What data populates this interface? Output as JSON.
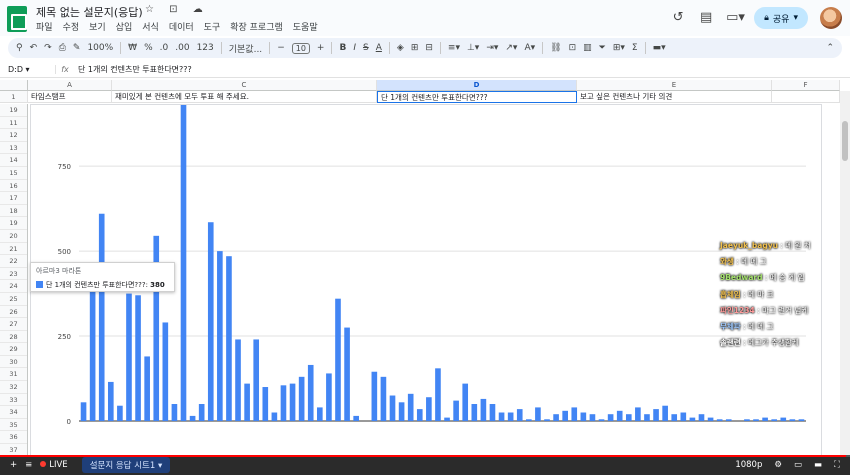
{
  "app": {
    "title": "제목 없는 설문지(응답)",
    "title_icons": "☆ ⊡ ☁",
    "menu": [
      "파일",
      "수정",
      "보기",
      "삽입",
      "서식",
      "데이터",
      "도구",
      "확장 프로그램",
      "도움말"
    ],
    "share_label": "공유",
    "icons": {
      "history": "history-icon",
      "comment": "comment-icon",
      "meet": "video-icon",
      "lock": "lock-icon"
    }
  },
  "toolbar": {
    "zoom": "100%",
    "currency": "₩",
    "percent": "%",
    "dec_dec": ".0",
    "dec_inc": ".00",
    "number_fmt": "123",
    "font": "기본값...",
    "font_size": "10",
    "minus": "−",
    "plus": "+",
    "bold": "B",
    "italic": "I",
    "strike": "S",
    "text_color": "A",
    "sigma": "Σ"
  },
  "formula_bar": {
    "name_box": "D:D",
    "fx": "fx",
    "formula": "단 1개의 컨텐츠만 투표한다면???"
  },
  "grid": {
    "columns": [
      {
        "letter": "A",
        "selected": false
      },
      {
        "letter": "C",
        "selected": false
      },
      {
        "letter": "D",
        "selected": true
      },
      {
        "letter": "E",
        "selected": false
      },
      {
        "letter": "F",
        "selected": false
      }
    ],
    "row1": {
      "num": "1",
      "cells": [
        "타임스탬프",
        "재미있게 본 컨텐츠에 모두 투표 해 주세요.",
        "단 1개의 컨텐츠만 투표한다면???",
        "보고 싶은 컨텐츠나 기타 의견",
        ""
      ]
    },
    "row_numbers": [
      "19",
      "11",
      "12",
      "13",
      "14",
      "15",
      "16",
      "17",
      "18",
      "19",
      "20",
      "21",
      "22",
      "23",
      "24",
      "25",
      "26",
      "27",
      "28",
      "29",
      "30",
      "31",
      "32",
      "33",
      "34",
      "35",
      "36",
      "37",
      "38"
    ]
  },
  "tooltip": {
    "category": "아르마3 마라톤",
    "series": "단 1개의 컨텐츠만 투표한다면???",
    "value": "380"
  },
  "chat": [
    {
      "user": "Jaeyuk_bagyu",
      "msg": "메 원 처"
    },
    {
      "user": "와생",
      "msg": "메 메 그"
    },
    {
      "user": "9Bedward",
      "msg": "메 승 게 임"
    },
    {
      "user": "흡체임",
      "msg": "메 마 크"
    },
    {
      "user": "파인1234",
      "msg": "마그 런거 넘케"
    },
    {
      "user": "무체파",
      "msg": "메 메 그"
    },
    {
      "user": "솔랜련",
      "msg": "메그가 주생함케"
    }
  ],
  "bottom": {
    "add": "+",
    "list": "≡",
    "live": "LIVE",
    "sheet_tab": "설문지 응답 시트1",
    "quality": "1080p",
    "progress": 0.995
  },
  "colors": {
    "bar": "#4285f4",
    "accent": "#1a73e8",
    "share": "#c2e7ff"
  },
  "chart_data": {
    "type": "bar",
    "title": "",
    "xlabel": "",
    "ylabel": "",
    "ylim": [
      0,
      930
    ],
    "yticks": [
      0,
      250,
      500,
      750
    ],
    "values": [
      55,
      380,
      610,
      115,
      45,
      375,
      370,
      190,
      545,
      290,
      50,
      930,
      15,
      50,
      585,
      500,
      485,
      240,
      110,
      240,
      100,
      25,
      105,
      110,
      130,
      165,
      40,
      140,
      360,
      275,
      15,
      0,
      145,
      130,
      75,
      55,
      80,
      35,
      70,
      155,
      10,
      60,
      110,
      50,
      65,
      50,
      25,
      25,
      35,
      5,
      40,
      5,
      20,
      30,
      40,
      25,
      20,
      5,
      20,
      30,
      20,
      40,
      20,
      35,
      45,
      20,
      25,
      10,
      20,
      10,
      5,
      5,
      0,
      5,
      5,
      10,
      5,
      10,
      5,
      5
    ]
  }
}
